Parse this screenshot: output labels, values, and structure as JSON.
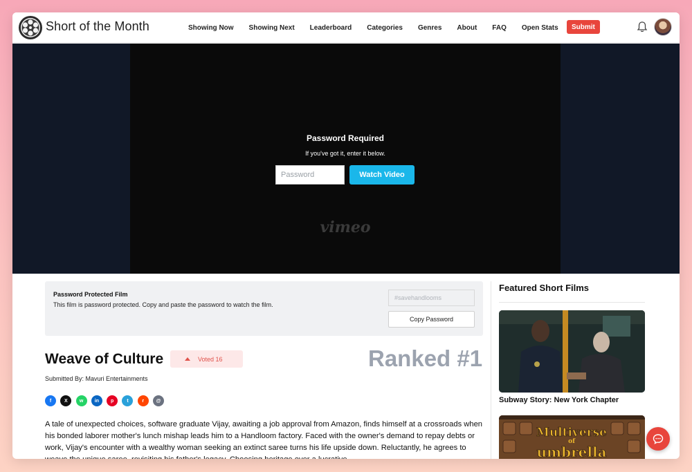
{
  "header": {
    "brand": "Short of the Month",
    "nav": [
      "Showing Now",
      "Showing Next",
      "Leaderboard",
      "Categories",
      "Genres",
      "About",
      "FAQ",
      "Open Stats"
    ],
    "submit_label": "Submit"
  },
  "player": {
    "title": "Password Required",
    "subtitle": "If you've got it, enter it below.",
    "input_placeholder": "Password",
    "watch_label": "Watch Video",
    "watermark": "vimeo"
  },
  "notice": {
    "title": "Password Protected Film",
    "text": "This film is password protected. Copy and paste the password to watch the film.",
    "password_value": "#savehandlooms",
    "copy_label": "Copy Password"
  },
  "film": {
    "title": "Weave of Culture",
    "vote_label": "Voted 16",
    "rank": "Ranked #1",
    "submitted_by": "Submitted By: Mavuri Entertainments",
    "description": "A tale of unexpected choices, software graduate Vijay, awaiting a job approval from Amazon, finds himself at a crossroads when his bonded laborer mother's lunch mishap leads him to a Handloom factory. Faced with the owner's demand to repay debts or work, Vijay's encounter with a wealthy woman seeking an extinct saree turns his life upside down. Reluctantly, he agrees to weave the unique saree, revisiting his father's legacy. Choosing heritage over a lucrative"
  },
  "share_icons": [
    {
      "name": "facebook-icon",
      "color": "#1877f2",
      "glyph": "f"
    },
    {
      "name": "x-icon",
      "color": "#111111",
      "glyph": "X"
    },
    {
      "name": "whatsapp-icon",
      "color": "#25d366",
      "glyph": "w"
    },
    {
      "name": "linkedin-icon",
      "color": "#0a66c2",
      "glyph": "in"
    },
    {
      "name": "pinterest-icon",
      "color": "#e60023",
      "glyph": "p"
    },
    {
      "name": "telegram-icon",
      "color": "#2aa1da",
      "glyph": "t"
    },
    {
      "name": "reddit-icon",
      "color": "#ff4500",
      "glyph": "r"
    },
    {
      "name": "email-icon",
      "color": "#6b7280",
      "glyph": "@"
    }
  ],
  "sidebar": {
    "title": "Featured Short Films",
    "cards": [
      {
        "title": "Subway Story: New York Chapter"
      },
      {
        "poster_text_1": "Multiverse",
        "poster_text_2": "of",
        "poster_text_3": "umbrella"
      }
    ]
  },
  "colors": {
    "accent_red": "#e8453c",
    "vimeo_blue": "#1ab7ea",
    "rank_gray": "#9ca3af"
  }
}
